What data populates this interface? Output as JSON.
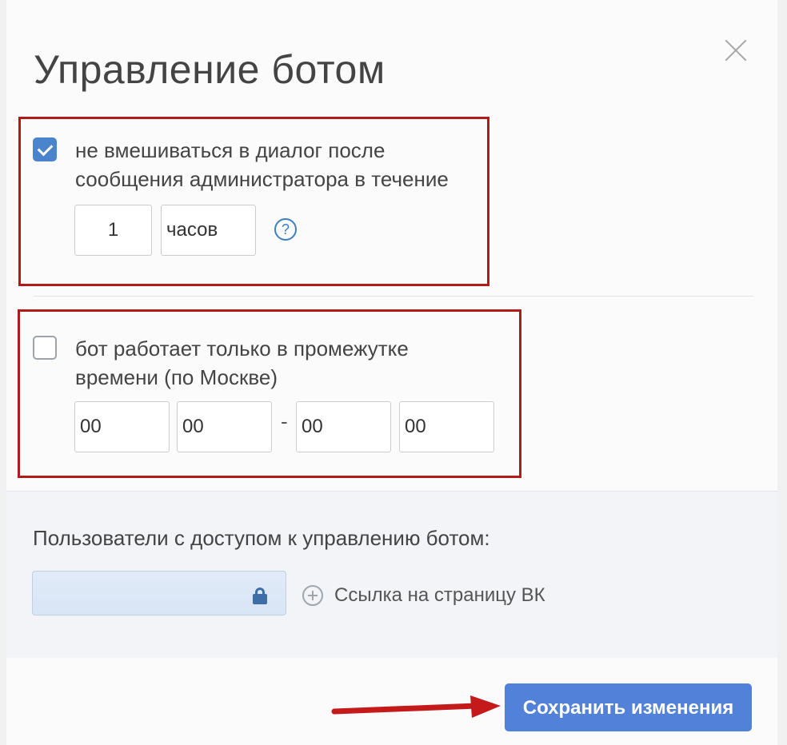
{
  "dialog": {
    "title": "Управление ботом",
    "close_icon": "close-icon"
  },
  "option1": {
    "checked": true,
    "label_line1": "не вмешиваться в диалог после",
    "label_line2": "сообщения администратора в течение",
    "amount_value": "1",
    "unit_value": "часов",
    "help_glyph": "?"
  },
  "option2": {
    "checked": false,
    "label_line1": "бот работает только в промежутке",
    "label_line2": "времени (по Москве)",
    "from_hours": "00",
    "from_minutes": "00",
    "separator": "-",
    "to_hours": "00",
    "to_minutes": "00"
  },
  "access": {
    "label": "Пользователи с доступом к управлению ботом:",
    "input_icon": "lock-icon",
    "add_link": "Ссылка на страницу ВК",
    "add_icon": "plus-circle-icon"
  },
  "footer": {
    "save_label": "Сохранить изменения"
  },
  "colors": {
    "accent": "#5181d8",
    "checkbox_checked": "#4a84cc",
    "highlight_border": "#b01a1a",
    "arrow": "#c41a1a"
  }
}
